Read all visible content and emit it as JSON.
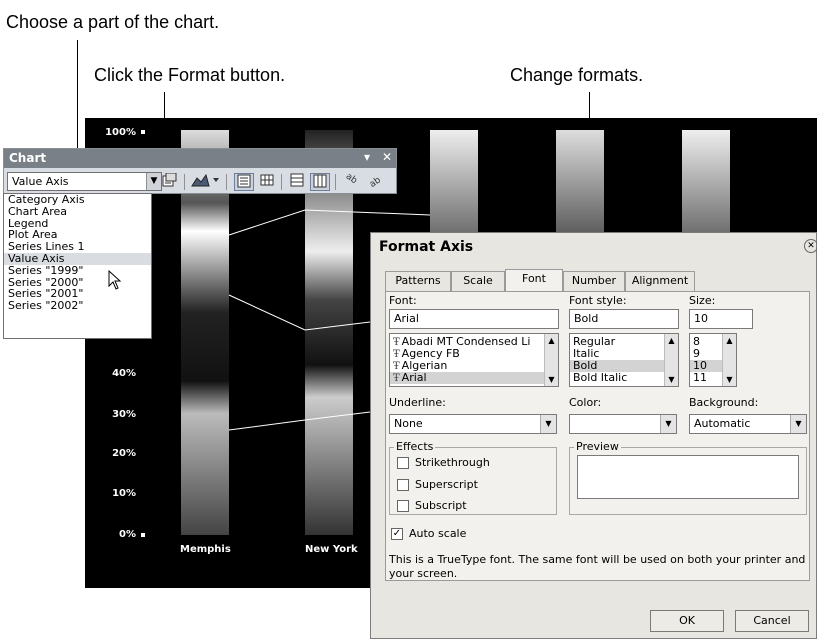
{
  "callouts": {
    "choose_part": "Choose a part of the chart.",
    "click_format": "Click the Format button.",
    "change_formats": "Change formats."
  },
  "chart": {
    "y_ticks": [
      "100%",
      "40%",
      "30%",
      "20%",
      "10%",
      "0%"
    ],
    "categories": [
      "Memphis",
      "New York"
    ]
  },
  "toolbar": {
    "title": "Chart",
    "combo_value": "Value Axis",
    "icons": {
      "format": "format-selected-object-icon",
      "chart_type": "chart-type-icon",
      "legend": "legend-icon",
      "data_table": "data-table-icon",
      "by_row": "by-row-icon",
      "by_column": "by-column-icon",
      "angle_down": "angle-text-downward-icon",
      "angle_up": "angle-text-upward-icon"
    }
  },
  "dropdown": {
    "items": [
      "Category Axis",
      "Chart Area",
      "Legend",
      "Plot Area",
      "Series Lines 1",
      "Value Axis",
      "Series \"1999\"",
      "Series \"2000\"",
      "Series \"2001\"",
      "Series \"2002\""
    ],
    "selected": "Value Axis"
  },
  "dialog": {
    "title": "Format Axis",
    "tabs": [
      "Patterns",
      "Scale",
      "Font",
      "Number",
      "Alignment"
    ],
    "active_tab": "Font",
    "font_label": "Font:",
    "font_value": "Arial",
    "font_list": [
      "Abadi MT Condensed Li",
      "Agency FB",
      "Algerian",
      "Arial"
    ],
    "font_style_label": "Font style:",
    "font_style_value": "Bold",
    "style_list": [
      "Regular",
      "Italic",
      "Bold",
      "Bold Italic"
    ],
    "size_label": "Size:",
    "size_value": "10",
    "size_list": [
      "8",
      "9",
      "10",
      "11"
    ],
    "underline_label": "Underline:",
    "underline_value": "None",
    "color_label": "Color:",
    "color_value": "",
    "background_label": "Background:",
    "background_value": "Automatic",
    "effects_label": "Effects",
    "strikethrough": "Strikethrough",
    "superscript": "Superscript",
    "subscript": "Subscript",
    "preview_label": "Preview",
    "auto_scale": "Auto scale",
    "auto_scale_checked": true,
    "note": "This is a TrueType font.  The same font will be used on both your printer and your screen.",
    "ok": "OK",
    "cancel": "Cancel"
  }
}
